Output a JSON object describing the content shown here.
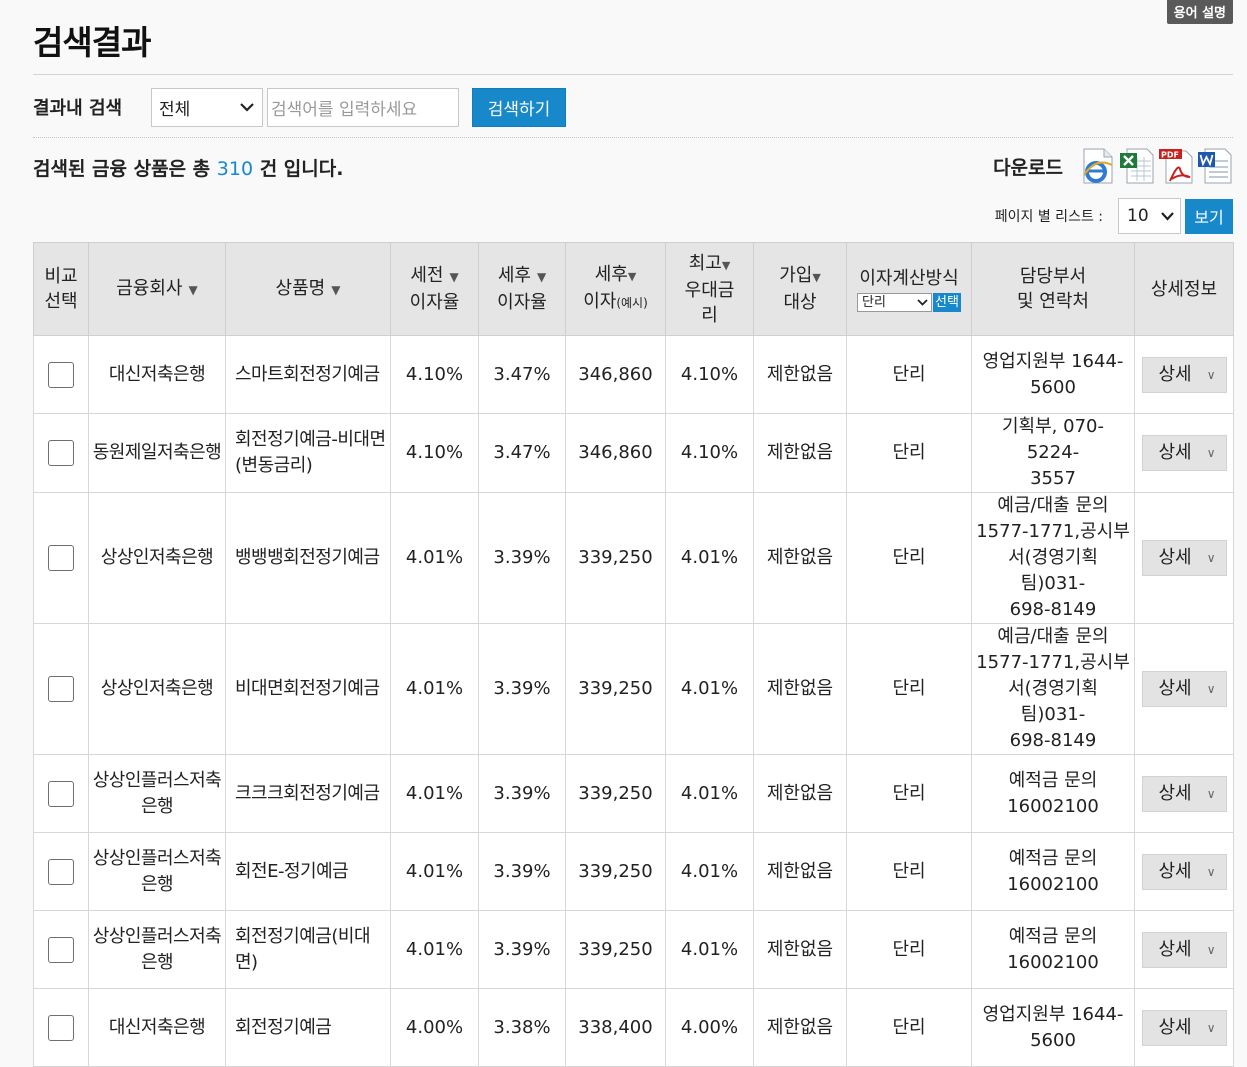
{
  "glossary": "용어 설명",
  "title": "검색결과",
  "search": {
    "label": "결과내 검색",
    "select_value": "전체",
    "placeholder": "검색어를 입력하세요",
    "button": "검색하기"
  },
  "result": {
    "prefix": "검색된 금융 상품은 총",
    "count": "310",
    "suffix": "건 입니다."
  },
  "download": {
    "label": "다운로드",
    "icons": [
      "ie-icon",
      "excel-icon",
      "pdf-icon",
      "word-icon"
    ]
  },
  "pagesize": {
    "label": "페이지 별 리스트 :",
    "value": "10",
    "button": "보기"
  },
  "table": {
    "headers": {
      "compare_1": "비교",
      "compare_2": "선택",
      "company": "금융회사",
      "product": "상품명",
      "pre_1": "세전",
      "pre_2": "이자율",
      "post_1": "세후",
      "post_2": "이자율",
      "interest_1": "세후",
      "interest_2": "이자",
      "interest_note": "(예시)",
      "max_1": "최고",
      "max_2": "우대금",
      "max_3": "리",
      "join_1": "가입",
      "join_2": "대상",
      "calc": "이자계산방식",
      "calc_select": "단리",
      "calc_button": "선택",
      "contact_1": "담당부서",
      "contact_2": "및 연락처",
      "detail": "상세정보"
    },
    "rows": [
      {
        "company": [
          "대신저축은행"
        ],
        "product": [
          "스마트회전정기예금"
        ],
        "pre": "4.10%",
        "post": "3.47%",
        "interest": "346,860",
        "max": "4.10%",
        "join": "제한없음",
        "calc": "단리",
        "contact": [
          "영업지원부 1644-",
          "5600"
        ],
        "detail": "상세"
      },
      {
        "company": [
          "동원제일저축은행"
        ],
        "product": [
          "회전정기예금-비대면",
          "(변동금리)"
        ],
        "pre": "4.10%",
        "post": "3.47%",
        "interest": "346,860",
        "max": "4.10%",
        "join": "제한없음",
        "calc": "단리",
        "contact": [
          "기획부, 070-5224-",
          "3557"
        ],
        "detail": "상세"
      },
      {
        "company": [
          "상상인저축은행"
        ],
        "product": [
          "뱅뱅뱅회전정기예금"
        ],
        "pre": "4.01%",
        "post": "3.39%",
        "interest": "339,250",
        "max": "4.01%",
        "join": "제한없음",
        "calc": "단리",
        "contact": [
          "예금/대출 문의",
          "1577-1771,공시부",
          "서(경영기획팀)031-",
          "698-8149"
        ],
        "detail": "상세"
      },
      {
        "company": [
          "상상인저축은행"
        ],
        "product": [
          "비대면회전정기예금"
        ],
        "pre": "4.01%",
        "post": "3.39%",
        "interest": "339,250",
        "max": "4.01%",
        "join": "제한없음",
        "calc": "단리",
        "contact": [
          "예금/대출 문의",
          "1577-1771,공시부",
          "서(경영기획팀)031-",
          "698-8149"
        ],
        "detail": "상세"
      },
      {
        "company": [
          "상상인플러스저축",
          "은행"
        ],
        "product": [
          "크크크회전정기예금"
        ],
        "pre": "4.01%",
        "post": "3.39%",
        "interest": "339,250",
        "max": "4.01%",
        "join": "제한없음",
        "calc": "단리",
        "contact": [
          "예적금 문의",
          "16002100"
        ],
        "detail": "상세"
      },
      {
        "company": [
          "상상인플러스저축",
          "은행"
        ],
        "product": [
          "회전E-정기예금"
        ],
        "pre": "4.01%",
        "post": "3.39%",
        "interest": "339,250",
        "max": "4.01%",
        "join": "제한없음",
        "calc": "단리",
        "contact": [
          "예적금 문의",
          "16002100"
        ],
        "detail": "상세"
      },
      {
        "company": [
          "상상인플러스저축",
          "은행"
        ],
        "product": [
          "회전정기예금(비대면)"
        ],
        "pre": "4.01%",
        "post": "3.39%",
        "interest": "339,250",
        "max": "4.01%",
        "join": "제한없음",
        "calc": "단리",
        "contact": [
          "예적금 문의",
          "16002100"
        ],
        "detail": "상세"
      },
      {
        "company": [
          "대신저축은행"
        ],
        "product": [
          "회전정기예금"
        ],
        "pre": "4.00%",
        "post": "3.38%",
        "interest": "338,400",
        "max": "4.00%",
        "join": "제한없음",
        "calc": "단리",
        "contact": [
          "영업지원부 1644-",
          "5600"
        ],
        "detail": "상세"
      }
    ]
  }
}
